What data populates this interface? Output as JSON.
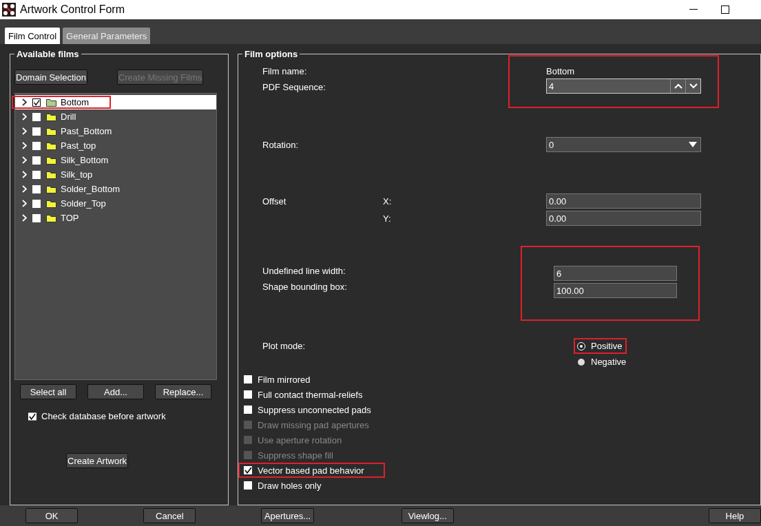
{
  "window": {
    "title": "Artwork Control Form"
  },
  "tabs": [
    {
      "label": "Film Control",
      "selected": true
    },
    {
      "label": "General Parameters",
      "selected": false
    }
  ],
  "available_films": {
    "title": "Available films",
    "top_buttons": [
      {
        "label": "Domain Selection",
        "disabled": false
      },
      {
        "label": "Create Missing Films",
        "disabled": true
      }
    ],
    "films": [
      {
        "name": "Bottom",
        "checked": true,
        "selected": true,
        "highlighted": true
      },
      {
        "name": "Drill",
        "checked": false,
        "selected": false,
        "highlighted": false
      },
      {
        "name": "Past_Bottom",
        "checked": false,
        "selected": false,
        "highlighted": false
      },
      {
        "name": "Past_top",
        "checked": false,
        "selected": false,
        "highlighted": false
      },
      {
        "name": "Silk_Bottom",
        "checked": false,
        "selected": false,
        "highlighted": false
      },
      {
        "name": "Silk_top",
        "checked": false,
        "selected": false,
        "highlighted": false
      },
      {
        "name": "Solder_Bottom",
        "checked": false,
        "selected": false,
        "highlighted": false
      },
      {
        "name": "Solder_Top",
        "checked": false,
        "selected": false,
        "highlighted": false
      },
      {
        "name": "TOP",
        "checked": false,
        "selected": false,
        "highlighted": false
      }
    ],
    "list_buttons": [
      "Select all",
      "Add...",
      "Replace..."
    ],
    "check_database": {
      "label": "Check database before artwork",
      "checked": true
    },
    "create_button": "Create Artwork"
  },
  "film_options": {
    "title": "Film options",
    "name_block_highlighted": true,
    "film_name": {
      "label": "Film name:",
      "value": "Bottom"
    },
    "pdf_sequence": {
      "label": "PDF Sequence:",
      "value": "4"
    },
    "rotation": {
      "label": "Rotation:",
      "value": "0"
    },
    "offset": {
      "label": "Offset",
      "x_label": "X:",
      "x_value": "0.00",
      "y_label": "Y:",
      "y_value": "0.00"
    },
    "width_block_highlighted": true,
    "undefined_line_width": {
      "label": "Undefined line width:",
      "value": "6"
    },
    "shape_bounding_box": {
      "label": "Shape bounding box:",
      "value": "100.00"
    },
    "plot_mode": {
      "label": "Plot mode:",
      "options": [
        {
          "label": "Positive",
          "selected": true,
          "highlighted": true
        },
        {
          "label": "Negative",
          "selected": false,
          "highlighted": false
        }
      ]
    },
    "options": [
      {
        "label": "Film mirrored",
        "checked": false,
        "disabled": false,
        "highlighted": false
      },
      {
        "label": "Full contact thermal-reliefs",
        "checked": false,
        "disabled": false,
        "highlighted": false
      },
      {
        "label": "Suppress unconnected pads",
        "checked": false,
        "disabled": false,
        "highlighted": false
      },
      {
        "label": "Draw missing pad apertures",
        "checked": false,
        "disabled": true,
        "highlighted": false
      },
      {
        "label": "Use aperture rotation",
        "checked": false,
        "disabled": true,
        "highlighted": false
      },
      {
        "label": "Suppress shape fill",
        "checked": false,
        "disabled": true,
        "highlighted": false
      },
      {
        "label": "Vector based pad behavior",
        "checked": true,
        "disabled": false,
        "highlighted": true
      },
      {
        "label": "Draw holes only",
        "checked": false,
        "disabled": false,
        "highlighted": false
      }
    ]
  },
  "footer_buttons": [
    "OK",
    "Cancel",
    "Apertures...",
    "Viewlog...",
    "Help"
  ]
}
